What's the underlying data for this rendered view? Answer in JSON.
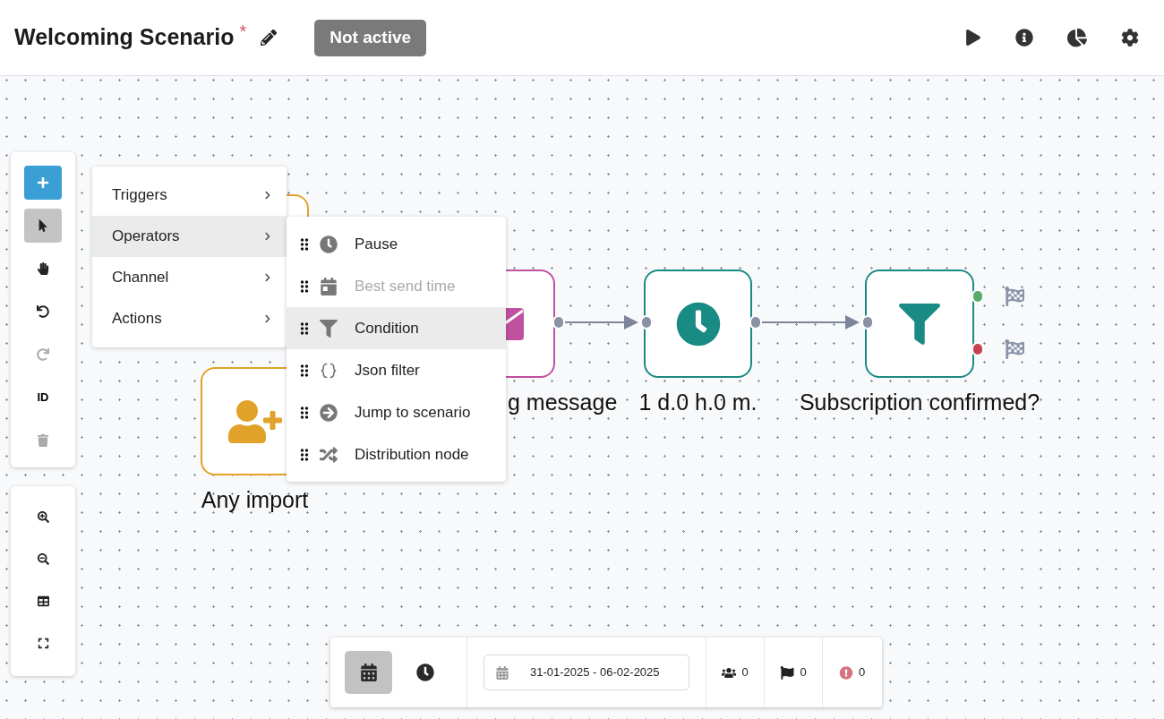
{
  "header": {
    "title": "Welcoming Scenario",
    "required_mark": "*",
    "status": {
      "label": "Not active",
      "active": false
    }
  },
  "tools": [
    {
      "kind": "add",
      "selected": false,
      "disabled": false
    },
    {
      "kind": "pointer",
      "selected": true,
      "disabled": false
    },
    {
      "kind": "hand",
      "selected": false,
      "disabled": false
    },
    {
      "kind": "undo",
      "selected": false,
      "disabled": false
    },
    {
      "kind": "redo",
      "selected": false,
      "disabled": true
    },
    {
      "kind": "id",
      "label": "ID",
      "selected": false,
      "disabled": false
    },
    {
      "kind": "delete",
      "selected": false,
      "disabled": true
    }
  ],
  "zoom_tools": [
    {
      "kind": "zoom-in"
    },
    {
      "kind": "zoom-out"
    },
    {
      "kind": "grid"
    },
    {
      "kind": "fit"
    }
  ],
  "menu": {
    "items": [
      {
        "label": "Triggers",
        "selected": false
      },
      {
        "label": "Operators",
        "selected": true
      },
      {
        "label": "Channel",
        "selected": false
      },
      {
        "label": "Actions",
        "selected": false
      }
    ],
    "submenu": [
      {
        "kind": "pause",
        "label": "Pause",
        "selected": false,
        "disabled": false
      },
      {
        "kind": "best-send-time",
        "label": "Best send time",
        "selected": false,
        "disabled": true
      },
      {
        "kind": "condition",
        "label": "Condition",
        "selected": true,
        "disabled": false
      },
      {
        "kind": "json",
        "label": "Json filter",
        "selected": false,
        "disabled": false
      },
      {
        "kind": "jump",
        "label": "Jump to scenario",
        "selected": false,
        "disabled": false
      },
      {
        "kind": "distribution",
        "label": "Distribution node",
        "selected": false,
        "disabled": false
      }
    ]
  },
  "nodes": [
    {
      "kind": "hidden-trigger",
      "color": "#e0a229"
    },
    {
      "kind": "trigger",
      "label": "Any import",
      "color": "#e0a229"
    },
    {
      "kind": "email",
      "label": "g message",
      "color": "#c050a0"
    },
    {
      "kind": "pause",
      "label": "1 d.0 h.0 m.",
      "color": "#1a8a84"
    },
    {
      "kind": "condition",
      "label": "Subscription confirmed?",
      "color": "#1a8a84",
      "outputs": [
        {
          "color": "#5aaa6a"
        },
        {
          "color": "#c4434f"
        }
      ]
    }
  ],
  "bottom_bar": {
    "views": [
      {
        "kind": "calendar",
        "selected": true
      },
      {
        "kind": "clock",
        "selected": false
      }
    ],
    "date_range": "31-01-2025 - 06-02-2025",
    "counts": [
      {
        "kind": "users",
        "value": "0"
      },
      {
        "kind": "flag",
        "value": "0"
      },
      {
        "kind": "error",
        "value": "0"
      }
    ]
  }
}
